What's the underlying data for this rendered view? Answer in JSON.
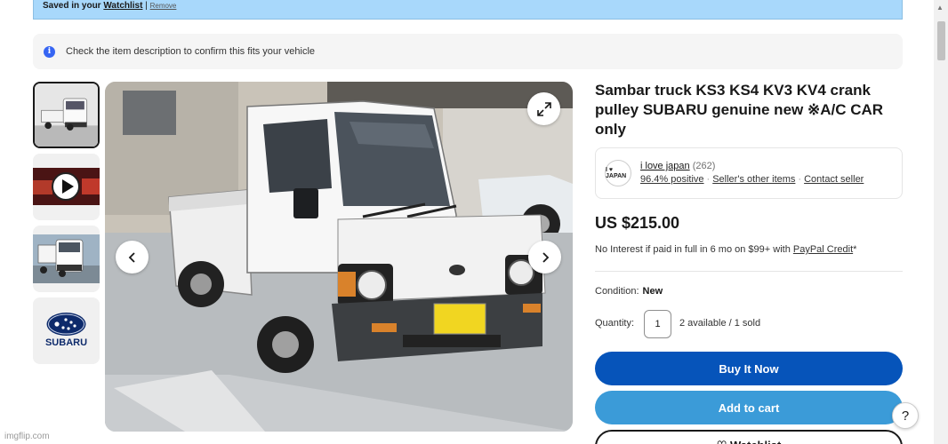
{
  "banner": {
    "saved_prefix": "Saved in your ",
    "watchlist_link": "Watchlist",
    "separator": " | ",
    "remove_link": "Remove"
  },
  "info_bar": {
    "icon": "info-icon",
    "text": "Check the item description to confirm this fits your vehicle"
  },
  "thumbnails": [
    {
      "name": "white truck side view",
      "active": true
    },
    {
      "name": "video",
      "icon": "play-icon"
    },
    {
      "name": "white truck front view",
      "active": false
    },
    {
      "name": "subaru logo",
      "text": "SUBARU"
    }
  ],
  "gallery": {
    "prev_icon": "chevron-left-icon",
    "next_icon": "chevron-right-icon",
    "expand_icon": "expand-icon"
  },
  "listing": {
    "title": "Sambar truck KS3 KS4 KV3 KV4 crank pulley SUBARU genuine new ※A/C CAR only",
    "price": "US $215.00",
    "credit_text": "No Interest if paid in full in 6 mo on $99+ with ",
    "credit_link": "PayPal Credit",
    "credit_suffix": "*",
    "condition_label": "Condition:",
    "condition_value": "New",
    "quantity_label": "Quantity:",
    "quantity_value": "1",
    "availability": "2 available / 1 sold"
  },
  "seller": {
    "avatar_text": "I ♥ JAPAN",
    "name": "i love japan",
    "feedback_count": "(262)",
    "positive": "96.4% positive",
    "other_items": "Seller's other items",
    "contact": "Contact seller",
    "dot": "·"
  },
  "buttons": {
    "buy_now": "Buy It Now",
    "add_to_cart": "Add to cart",
    "watchlist": "♡ Watchlist"
  },
  "help": "?",
  "watermark": "imgflip.com",
  "colors": {
    "buy_now": "#0654ba",
    "add_to_cart": "#3b9bd8",
    "banner": "#a8d8fb",
    "info_icon": "#3665f3"
  }
}
